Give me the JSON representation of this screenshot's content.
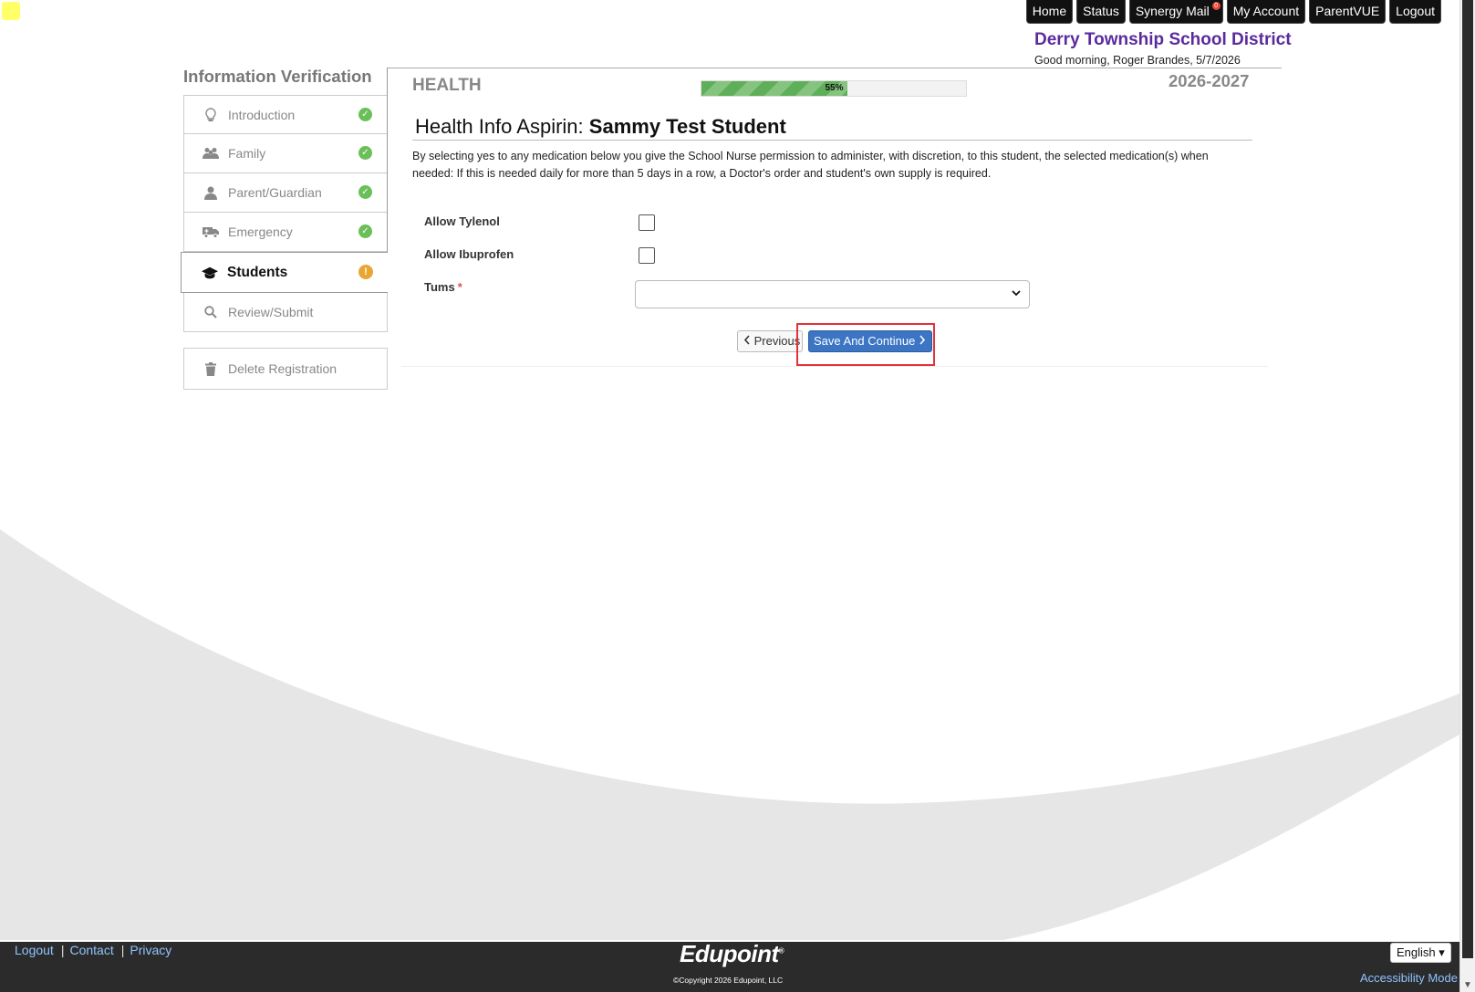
{
  "top_nav": {
    "items": [
      {
        "label": "Home"
      },
      {
        "label": "Status"
      },
      {
        "label": "Synergy Mail",
        "badge": "0"
      },
      {
        "label": "My Account"
      },
      {
        "label": "ParentVUE"
      },
      {
        "label": "Logout"
      }
    ]
  },
  "district": {
    "name": "Derry Township School District",
    "greeting": "Good morning, Roger Brandes, 5/7/2026"
  },
  "sidebar": {
    "title": "Information Verification",
    "items": [
      {
        "label": "Introduction",
        "icon": "lightbulb-icon",
        "status": "complete"
      },
      {
        "label": "Family",
        "icon": "users-icon",
        "status": "complete"
      },
      {
        "label": "Parent/Guardian",
        "icon": "user-icon",
        "status": "complete"
      },
      {
        "label": "Emergency",
        "icon": "ambulance-icon",
        "status": "complete"
      },
      {
        "label": "Students",
        "icon": "graduation-cap-icon",
        "status": "warning",
        "active": true
      },
      {
        "label": "Review/Submit",
        "icon": "search-icon",
        "status": ""
      }
    ],
    "delete_label": "Delete Registration"
  },
  "main": {
    "section_title": "HEALTH",
    "progress": {
      "percent": 55,
      "label": "55%"
    },
    "year": "2026-2027",
    "form_title_prefix": "Health Info Aspirin:",
    "form_title_student": "Sammy Test Student",
    "description": "By selecting yes to any medication below you give the School Nurse permission to administer, with discretion, to this student, the selected medication(s) when needed: If this is needed daily for more than 5 days in a row, a Doctor's order and student's own supply is required.",
    "fields": {
      "tylenol_label": "Allow Tylenol",
      "tylenol_checked": false,
      "ibuprofen_label": "Allow Ibuprofen",
      "ibuprofen_checked": false,
      "tums_label": "Tums",
      "tums_required": "*",
      "tums_value": ""
    },
    "buttons": {
      "previous": "Previous",
      "save": "Save And Continue"
    }
  },
  "footer": {
    "links": [
      "Logout",
      "Contact",
      "Privacy"
    ],
    "brand": "Edupoint",
    "copyright": "©Copyright 2026 Edupoint, LLC",
    "language": "English",
    "accessibility": "Accessibility Mode"
  },
  "colors": {
    "district_purple": "#5b2a9c",
    "save_blue": "#3b75c4",
    "progress_green": "#5fae5a",
    "highlight_red": "#e0333a",
    "complete_green": "#6bbf59",
    "warning_orange": "#e8a735"
  }
}
